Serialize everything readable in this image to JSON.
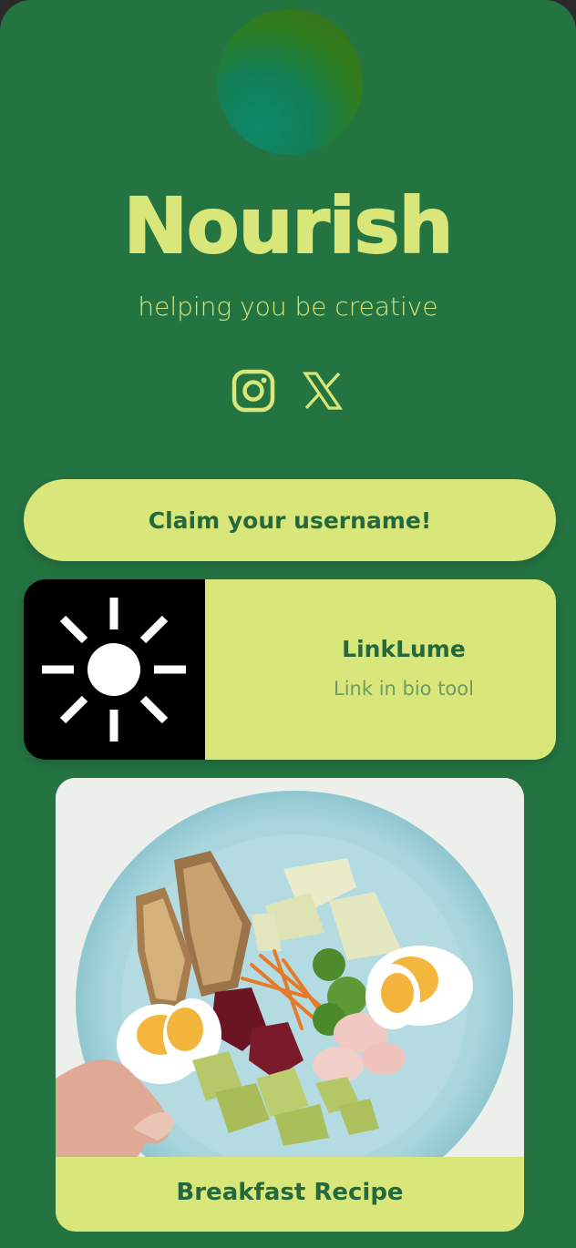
{
  "profile": {
    "name": "Nourish",
    "tagline": "helping you be creative"
  },
  "socials": [
    {
      "icon": "instagram-icon"
    },
    {
      "icon": "x-twitter-icon"
    }
  ],
  "cta": {
    "label": "Claim your username!"
  },
  "link_card": {
    "title": "LinkLume",
    "subtitle": "Link in bio tool",
    "thumbnail_icon": "sun-icon"
  },
  "recipe_card": {
    "label": "Breakfast Recipe",
    "image": "breakfast-plate-photo"
  },
  "colors": {
    "background": "#247442",
    "accent": "#d9e679",
    "text_dark": "#24693d",
    "text_muted": "#6f9a62"
  }
}
